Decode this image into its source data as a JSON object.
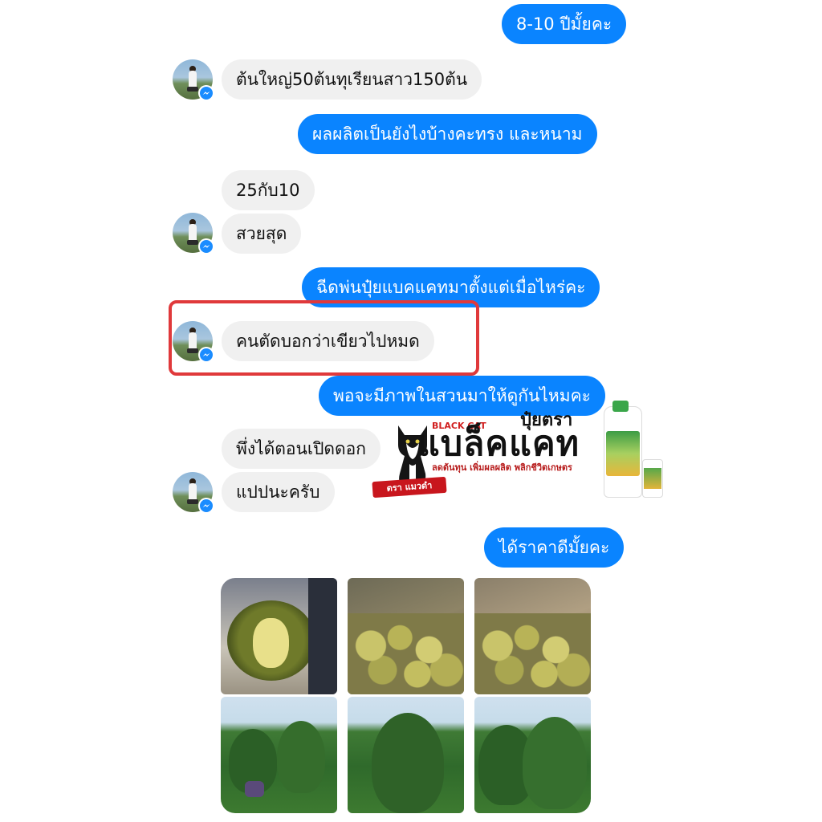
{
  "messages": {
    "m1": "8-10 ปีมั้ยคะ",
    "m2": "ต้นใหญ่50ต้นทุเรียนสาว150ต้น",
    "m3": "ผลผลิตเป็นยังไงบ้างคะทรง  และหนาม",
    "m4": "25กับ10",
    "m5": "สวยสุด",
    "m6": "ฉีดพ่นปุ๋ยแบคแคทมาตั้งแต่เมื่อไหร่คะ",
    "m7": "คนตัดบอกว่าเขียวไปหมด",
    "m8": "พอจะมีภาพในสวนมาให้ดูกันไหมคะ",
    "m9": "พึ่งได้ตอนเปิดดอก",
    "m10": "แปปนะครับ",
    "m11": "ได้ราคาดีมั้ยคะ"
  },
  "ad": {
    "brand_en": "BLACK CAT",
    "top_text": "ปุ๋ยตรา",
    "title": "แบล็คแคท",
    "subtitle": "ลดต้นทุน เพิ่มผลผลิต พลิกชีวิตเกษตร",
    "ribbon": "ตรา แมวดำ"
  },
  "colors": {
    "outgoing": "#0a84ff",
    "incoming": "#f0f0f0",
    "highlight": "#e0393b"
  },
  "icons": [
    "messenger-icon",
    "avatar"
  ]
}
